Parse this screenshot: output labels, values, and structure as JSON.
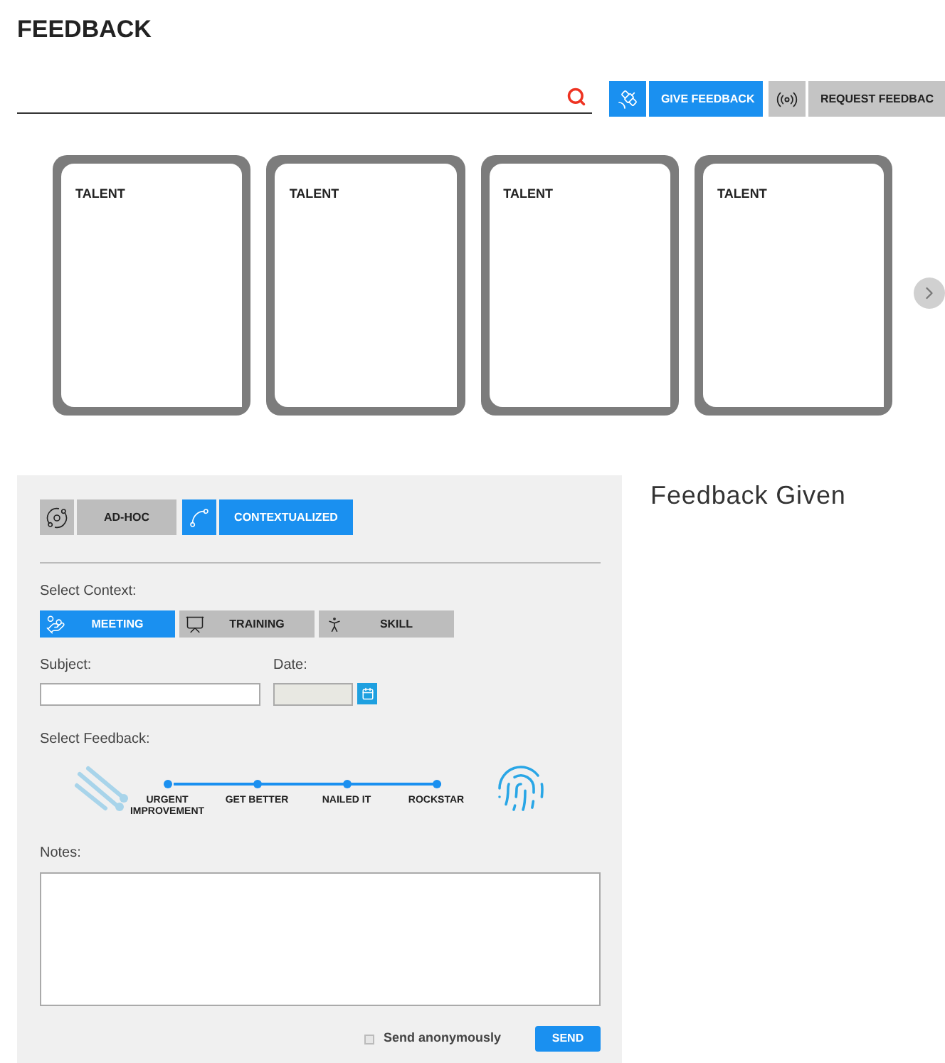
{
  "page_title": "FEEDBACK",
  "actions": [
    {
      "label": "GIVE FEEDBACK",
      "kind": "give",
      "selected": true
    },
    {
      "label": "REQUEST FEEDBAC",
      "kind": "request",
      "selected": false
    }
  ],
  "cards": [
    {
      "title": "TALENT"
    },
    {
      "title": "TALENT"
    },
    {
      "title": "TALENT"
    },
    {
      "title": "TALENT"
    }
  ],
  "form": {
    "modes": [
      {
        "label": "AD-HOC",
        "kind": "adhoc",
        "selected": false
      },
      {
        "label": "CONTEXTUALIZED",
        "kind": "context",
        "selected": true
      }
    ],
    "context_label": "Select Context:",
    "contexts": [
      {
        "label": "MEETING",
        "kind": "meeting",
        "selected": true
      },
      {
        "label": "TRAINING",
        "kind": "training",
        "selected": false
      },
      {
        "label": "SKILL",
        "kind": "skill",
        "selected": false
      }
    ],
    "subject_label": "Subject:",
    "date_label": "Date:",
    "feedback_label": "Select Feedback:",
    "scale": [
      {
        "label": "URGENT IMPROVEMENT"
      },
      {
        "label": "GET BETTER"
      },
      {
        "label": "NAILED IT"
      },
      {
        "label": "ROCKSTAR"
      }
    ],
    "notes_label": "Notes:",
    "anonymous": {
      "label": "Send anonymously",
      "checked": false
    },
    "send": "SEND"
  },
  "given_title": "Feedback Given"
}
